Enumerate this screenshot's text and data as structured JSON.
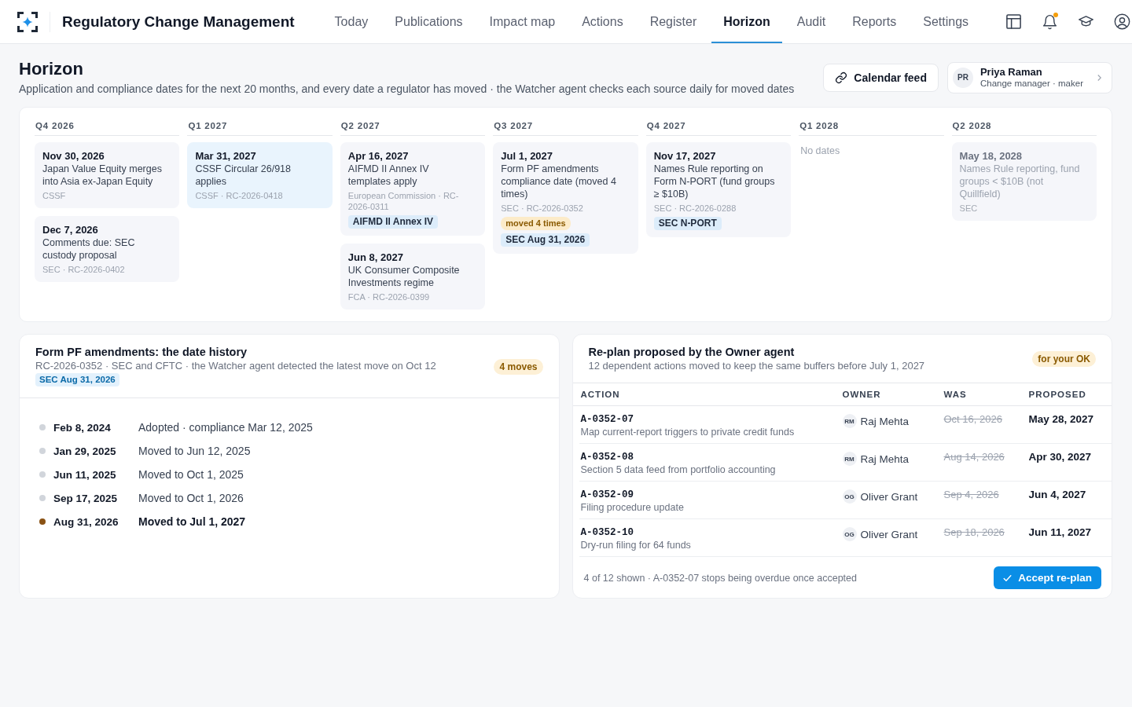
{
  "topbar": {
    "title": "Regulatory Change Management",
    "nav": [
      {
        "label": "Today",
        "selected": false
      },
      {
        "label": "Publications",
        "selected": false
      },
      {
        "label": "Impact map",
        "selected": false
      },
      {
        "label": "Actions",
        "selected": false
      },
      {
        "label": "Register",
        "selected": false
      },
      {
        "label": "Horizon",
        "selected": true
      },
      {
        "label": "Audit",
        "selected": false
      },
      {
        "label": "Reports",
        "selected": false
      },
      {
        "label": "Settings",
        "selected": false
      }
    ],
    "notifications_unread": true
  },
  "header": {
    "title": "Horizon",
    "subtitle": "Application and compliance dates for the next 20 months, and every date a regulator has moved · the Watcher agent checks each source daily for moved dates",
    "calendar_button": "Calendar feed",
    "user": {
      "initials": "PR",
      "name": "Priya Raman",
      "role": "Change manager · maker"
    }
  },
  "timeline": {
    "quarters": [
      {
        "label": "Q4 2026",
        "events": [
          {
            "date": "Nov 30, 2026",
            "title": "Japan Value Equity merges into Asia ex-Japan Equity",
            "source": "CSSF",
            "highlighted": false,
            "dimmed": false
          },
          {
            "date": "Dec 7, 2026",
            "title": "Comments due: SEC custody proposal",
            "source": "SEC · RC-2026-0402",
            "highlighted": false,
            "dimmed": false
          }
        ]
      },
      {
        "label": "Q1 2027",
        "events": [
          {
            "date": "Mar 31, 2027",
            "title": "CSSF Circular 26/918 applies",
            "source": "CSSF · RC-2026-0418",
            "highlighted": true,
            "dimmed": false
          }
        ]
      },
      {
        "label": "Q2 2027",
        "events": [
          {
            "date": "Apr 16, 2027",
            "title": "AIFMD II Annex IV templates apply",
            "source": "European Commission · RC-2026-0311",
            "highlighted": false,
            "dimmed": false,
            "tags": [
              {
                "label": "AIFMD II Annex IV",
                "kind": "reference"
              }
            ]
          },
          {
            "date": "Jun 8, 2027",
            "title": "UK Consumer Composite Investments regime",
            "source": "FCA · RC-2026-0399",
            "highlighted": false,
            "dimmed": false
          }
        ]
      },
      {
        "label": "Q3 2027",
        "events": [
          {
            "date": "Jul 1, 2027",
            "title": "Form PF amendments compliance date (moved 4 times)",
            "source": "SEC · RC-2026-0352",
            "highlighted": false,
            "dimmed": false,
            "tags": [
              {
                "label": "moved 4 times",
                "kind": "moved"
              },
              {
                "label": "SEC Aug 31, 2026",
                "kind": "reference"
              }
            ]
          }
        ]
      },
      {
        "label": "Q4 2027",
        "events": [
          {
            "date": "Nov 17, 2027",
            "title": "Names Rule reporting on Form N-PORT (fund groups ≥ $10B)",
            "source": "SEC · RC-2026-0288",
            "highlighted": false,
            "dimmed": false,
            "tags": [
              {
                "label": "SEC N-PORT",
                "kind": "reference"
              }
            ]
          }
        ]
      },
      {
        "label": "Q1 2028",
        "empty_text": "No dates"
      },
      {
        "label": "Q2 2028",
        "events": [
          {
            "date": "May 18, 2028",
            "title": "Names Rule reporting, fund groups < $10B (not Quillfield)",
            "source": "SEC",
            "highlighted": false,
            "dimmed": true
          }
        ]
      }
    ]
  },
  "history": {
    "title": "Form PF amendments: the date history",
    "subtitle": "RC-2026-0352 · SEC and CFTC · the Watcher agent detected the latest move on Oct 12",
    "tag": "SEC Aug 31, 2026",
    "badge": "4 moves",
    "entries": [
      {
        "date": "Feb 8, 2024",
        "text": "Adopted · compliance Mar 12, 2025",
        "current": false
      },
      {
        "date": "Jan 29, 2025",
        "text": "Moved to Jun 12, 2025",
        "current": false
      },
      {
        "date": "Jun 11, 2025",
        "text": "Moved to Oct 1, 2025",
        "current": false
      },
      {
        "date": "Sep 17, 2025",
        "text": "Moved to Oct 1, 2026",
        "current": false
      },
      {
        "date": "Aug 31, 2026",
        "text": "Moved to Jul 1, 2027",
        "current": true
      }
    ]
  },
  "replan": {
    "title": "Re-plan proposed by the Owner agent",
    "subtitle": "12 dependent actions moved to keep the same buffers before July 1, 2027",
    "badge": "for your OK",
    "columns": [
      "ACTION",
      "OWNER",
      "WAS",
      "PROPOSED"
    ],
    "rows": [
      {
        "id": "A-0352-07",
        "description": "Map current-report triggers to private credit funds",
        "owner_initials": "RM",
        "owner": "Raj Mehta",
        "was": "Oct 16, 2026",
        "proposed": "May 28, 2027"
      },
      {
        "id": "A-0352-08",
        "description": "Section 5 data feed from portfolio accounting",
        "owner_initials": "RM",
        "owner": "Raj Mehta",
        "was": "Aug 14, 2026",
        "proposed": "Apr 30, 2027"
      },
      {
        "id": "A-0352-09",
        "description": "Filing procedure update",
        "owner_initials": "OG",
        "owner": "Oliver Grant",
        "was": "Sep 4, 2026",
        "proposed": "Jun 4, 2027"
      },
      {
        "id": "A-0352-10",
        "description": "Dry-run filing for 64 funds",
        "owner_initials": "OG",
        "owner": "Oliver Grant",
        "was": "Sep 18, 2026",
        "proposed": "Jun 11, 2027"
      }
    ],
    "footer": "4 of 12 shown · A-0352-07 stops being overdue once accepted",
    "accept_button": "Accept re-plan"
  }
}
